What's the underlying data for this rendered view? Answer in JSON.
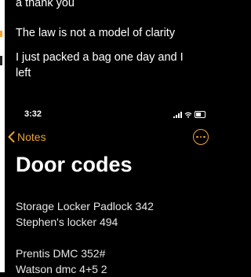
{
  "background_note": {
    "lines": [
      "a thank you",
      "The law is not a model of clarity",
      "I just packed a bag one day and I",
      "left"
    ]
  },
  "status_bar": {
    "time": "3:32"
  },
  "nav": {
    "back_label": "Notes",
    "accent_color": "#e8a531",
    "more_icon": "ellipsis-circle-icon"
  },
  "note": {
    "title": "Door codes",
    "lines": [
      "Storage Locker Padlock 342",
      "Stephen's locker 494",
      "",
      "Prentis DMC 352#",
      "Watson dmc 4+5 2"
    ]
  }
}
